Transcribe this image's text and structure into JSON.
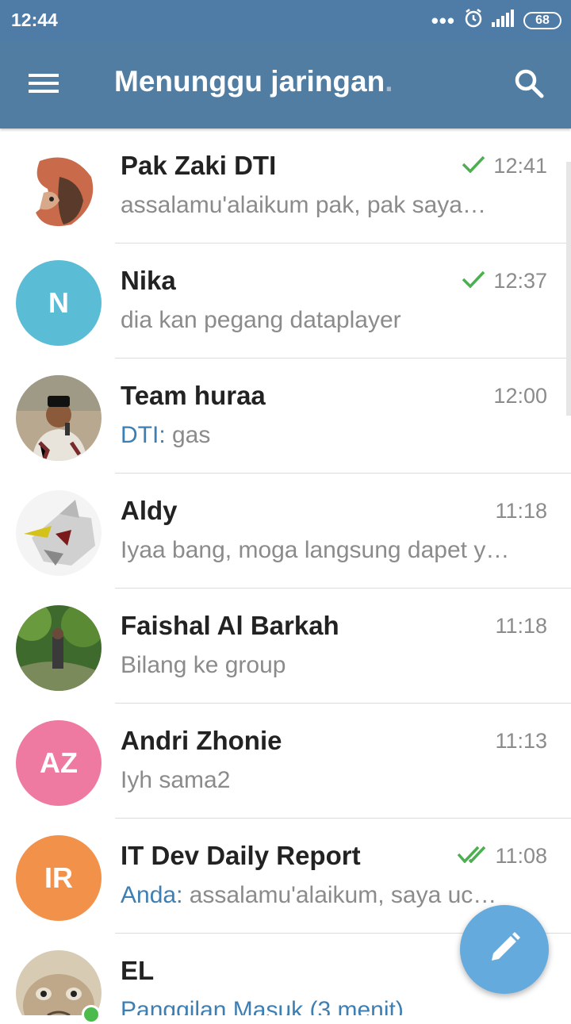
{
  "status_bar": {
    "time": "12:44",
    "battery": "68"
  },
  "toolbar": {
    "title": "Menunggu jaringan",
    "title_suffix": "."
  },
  "chats": [
    {
      "name": "Pak Zaki DTI",
      "time": "12:41",
      "sender": "",
      "preview": "assalamu'alaikum pak,   pak saya…",
      "status": "sent",
      "avatar": "cartoon",
      "avatar_color": "#6a4a3a"
    },
    {
      "name": "Nika",
      "time": "12:37",
      "sender": "",
      "preview": "dia kan pegang dataplayer",
      "status": "sent",
      "avatar": "N",
      "avatar_color": "#5bbcd6"
    },
    {
      "name": "Team huraa",
      "time": "12:00",
      "sender": "DTI: ",
      "preview": "gas",
      "status": "",
      "avatar": "photo-man",
      "avatar_color": "#8a7a6a"
    },
    {
      "name": "Aldy",
      "time": "11:18",
      "sender": "",
      "preview": "Iyaa bang, moga langsung dapet y…",
      "status": "",
      "avatar": "robot",
      "avatar_color": "#dddddd"
    },
    {
      "name": "Faishal Al Barkah",
      "time": "11:18",
      "sender": "",
      "preview": "Bilang ke group",
      "status": "",
      "avatar": "forest",
      "avatar_color": "#4f7a3a"
    },
    {
      "name": "Andri Zhonie",
      "time": "11:13",
      "sender": "",
      "preview": "Iyh sama2",
      "status": "",
      "avatar": "AZ",
      "avatar_color": "#ef7aa1"
    },
    {
      "name": "IT Dev Daily Report",
      "time": "11:08",
      "sender": "Anda: ",
      "preview": "assalamu'alaikum,  saya uc…",
      "status": "read",
      "avatar": "IR",
      "avatar_color": "#f2914a"
    },
    {
      "name": "EL",
      "time": "",
      "sender": "Panggilan Masuk (3 menit)",
      "preview": "",
      "status": "",
      "avatar": "cat",
      "avatar_color": "#c9b59a"
    }
  ],
  "icons": {
    "menu": "menu-icon",
    "search": "search-icon",
    "compose": "pencil-icon",
    "sent": "check-icon",
    "read": "double-check-icon"
  },
  "colors": {
    "header": "#527da3",
    "accent_link": "#3e7fb3",
    "check": "#4caf50",
    "fab": "#65aadd"
  }
}
